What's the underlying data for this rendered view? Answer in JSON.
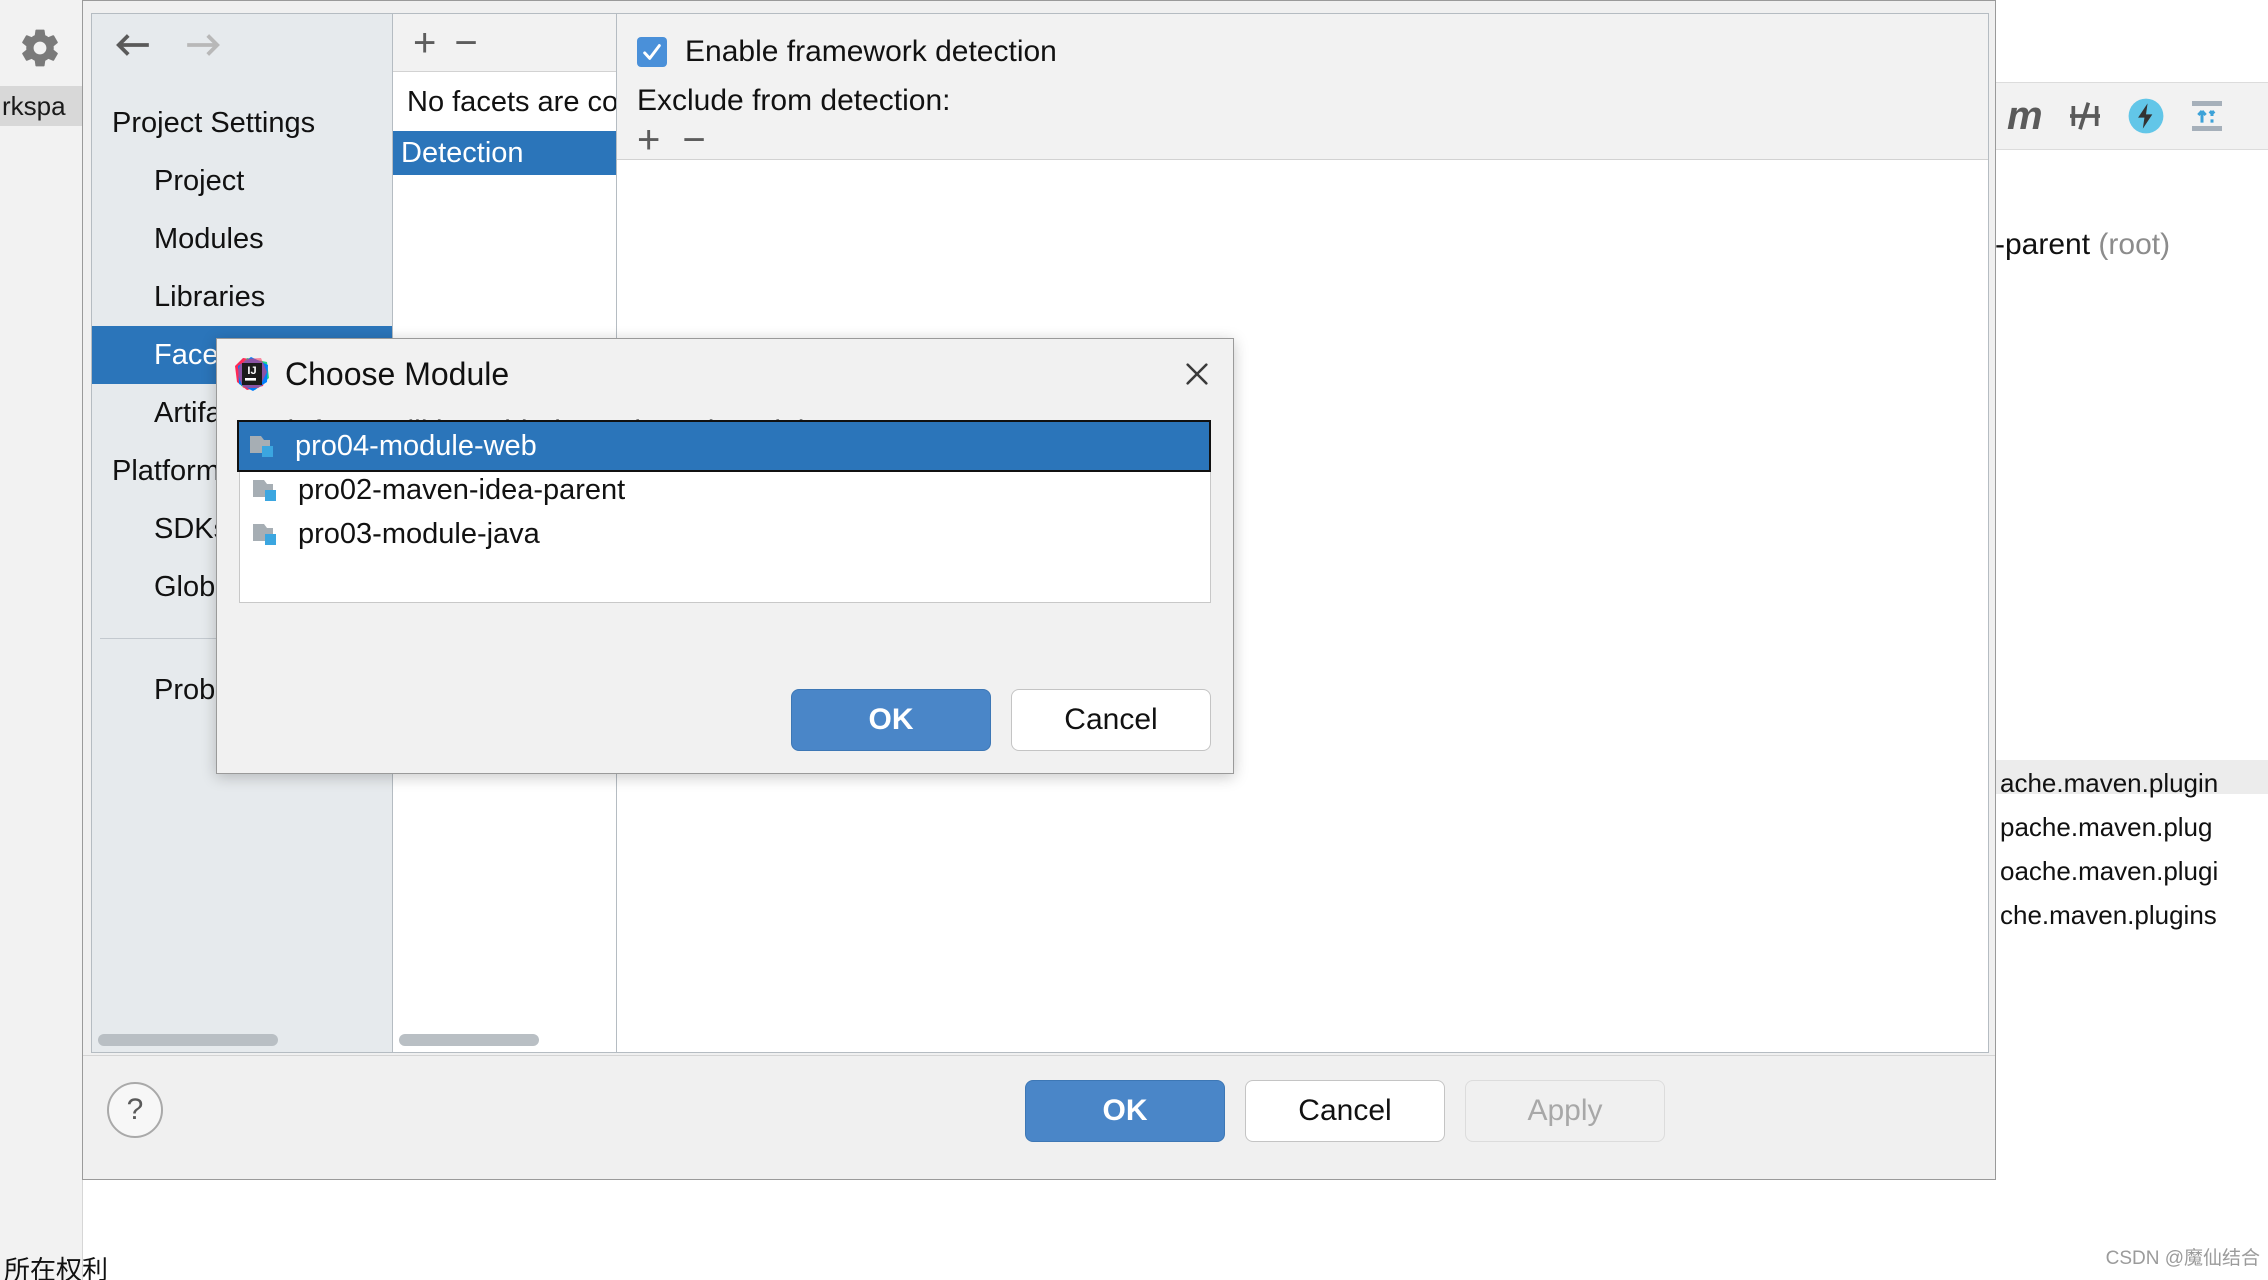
{
  "background": {
    "workspace_tab": "rkspa",
    "toolbar_icons": [
      "maven-m-icon",
      "skip-tests-icon",
      "execute-goal-icon",
      "expand-collapse-icon"
    ],
    "parent_label": "-parent",
    "parent_root": "(root)",
    "plugin_lines": [
      "ache.maven.plugin",
      "pache.maven.plug",
      "oache.maven.plugi",
      "che.maven.plugins"
    ],
    "bottom_text": "所在权利",
    "watermark": "CSDN @魔仙结合"
  },
  "project_structure": {
    "nav": {
      "back_icon": "arrow-left-icon",
      "forward_icon": "arrow-right-icon",
      "groups": [
        {
          "label": "Project Settings",
          "items": [
            "Project",
            "Modules",
            "Libraries",
            "Facets",
            "Artifacts"
          ]
        },
        {
          "label": "Platform Settin",
          "items": [
            "SDKs",
            "Global Lib"
          ]
        }
      ],
      "selected": "Facets",
      "extra_items": [
        "Problems"
      ]
    },
    "facets_panel": {
      "add_icon": "plus-icon",
      "remove_icon": "minus-icon",
      "empty_text": "No facets are co",
      "selected_row": "Detection"
    },
    "detection": {
      "enable_checkbox_label": "Enable framework detection",
      "enable_checkbox_checked": true,
      "exclude_label": "Exclude from detection:",
      "add_icon": "plus-icon",
      "remove_icon": "minus-icon"
    },
    "footer": {
      "help_label": "?",
      "ok_label": "OK",
      "cancel_label": "Cancel",
      "apply_label": "Apply"
    }
  },
  "choose_module_dialog": {
    "icon": "intellij-idea-icon",
    "title": "Choose Module",
    "close_icon": "close-icon",
    "subtitle": "Web facet will be added to selected module",
    "modules": [
      {
        "name": "pro02-maven-idea-parent",
        "selected": false
      },
      {
        "name": "pro03-module-java",
        "selected": false
      },
      {
        "name": "pro04-module-web",
        "selected": true
      }
    ],
    "ok_label": "OK",
    "cancel_label": "Cancel"
  },
  "colors": {
    "selection_blue": "#2b75ba",
    "primary_button": "#4a86c8",
    "checkbox_blue": "#4a90d9",
    "nav_background": "#e6eaed"
  }
}
